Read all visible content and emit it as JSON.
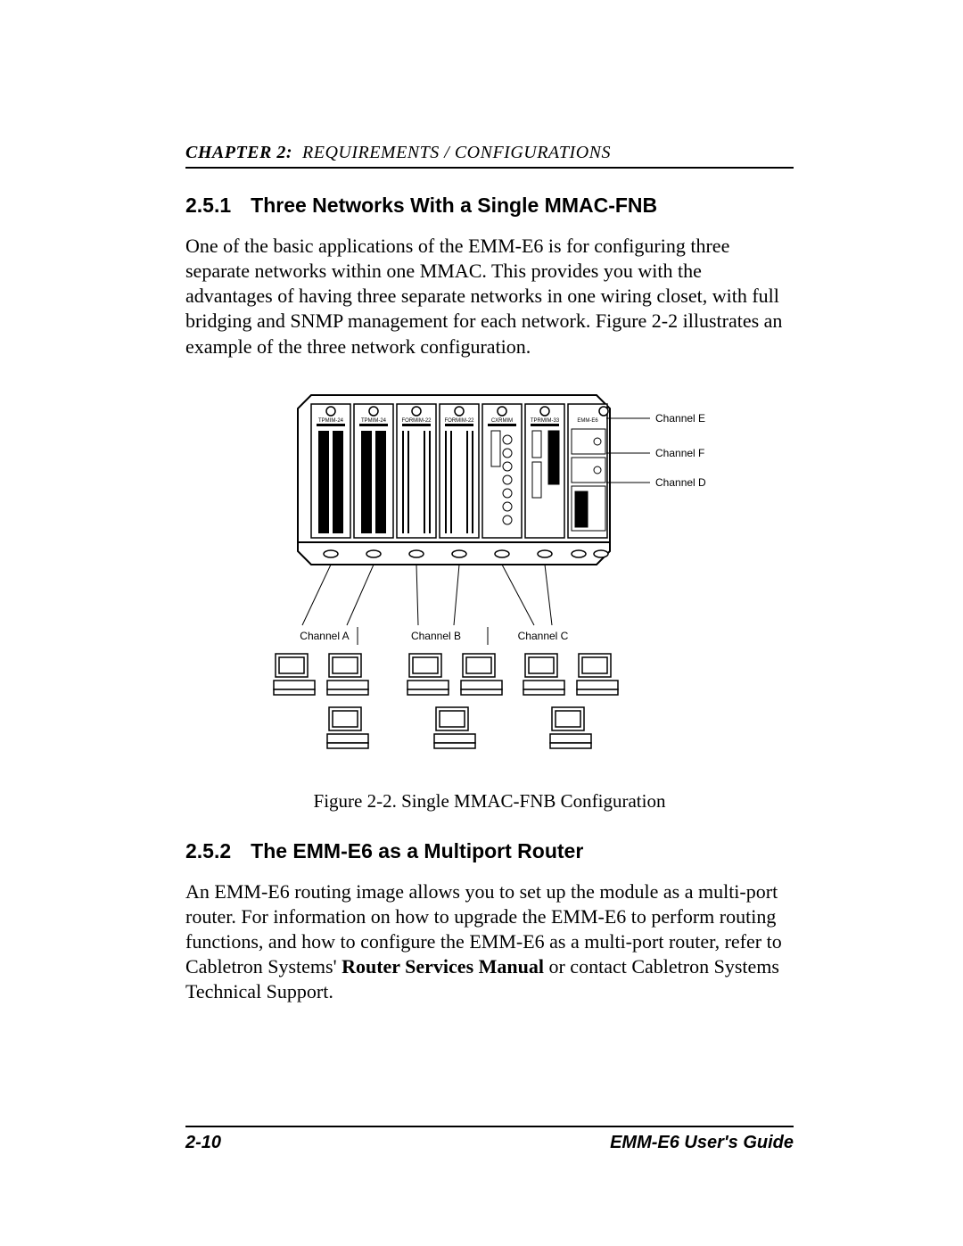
{
  "header": {
    "chapter_label": "CHAPTER 2:",
    "chapter_title": "REQUIREMENTS / CONFIGURATIONS"
  },
  "section_251": {
    "number": "2.5.1",
    "title": "Three Networks With a Single MMAC-FNB",
    "paragraph": "One of the basic applications of the EMM-E6 is for configuring three separate networks within one MMAC. This provides you with the advantages of having three separate networks in one wiring closet, with full bridging and SNMP management for each network. Figure 2-2 illustrates an example of the three network configuration."
  },
  "figure": {
    "caption": "Figure 2-2.  Single MMAC-FNB Configuration",
    "slots": [
      "TPMIM-24",
      "TPMIM-24",
      "FORMIM-22",
      "FORMIM-22",
      "CXRMIM",
      "TPRMIM-33",
      "EMM-E6"
    ],
    "right_labels": [
      "Channel E",
      "Channel F",
      "Channel D"
    ],
    "bottom_labels": [
      "Channel A",
      "Channel B",
      "Channel C"
    ]
  },
  "section_252": {
    "number": "2.5.2",
    "title": "The EMM-E6 as a Multiport Router",
    "para_before": "An EMM-E6 routing image allows you to set up the module as a multi-port router. For information on how to upgrade the EMM-E6 to perform routing functions, and how to configure the EMM-E6 as a multi-port router, refer to Cabletron Systems' ",
    "bold": "Router Services Manual",
    "para_after": " or contact Cabletron Systems Technical Support."
  },
  "footer": {
    "page": "2-10",
    "book": "EMM-E6 User's Guide"
  }
}
